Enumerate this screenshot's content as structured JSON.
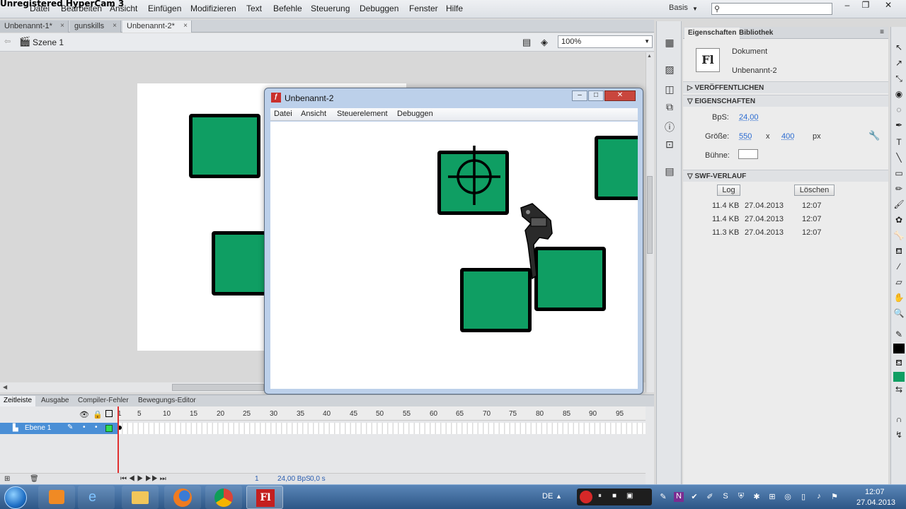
{
  "overlay": {
    "watermark": "Unregistered HyperCam 3"
  },
  "menubar": {
    "items": [
      "Datei",
      "Bearbeiten",
      "Ansicht",
      "Einfügen",
      "Modifizieren",
      "Text",
      "Befehle",
      "Steuerung",
      "Debuggen",
      "Fenster",
      "Hilfe"
    ],
    "workspace": "Basis",
    "search_placeholder": ""
  },
  "doc_tabs": [
    {
      "label": "Unbenannt-1*"
    },
    {
      "label": "gunskills"
    },
    {
      "label": "Unbenannt-2*"
    }
  ],
  "editbar": {
    "scene": "Szene 1",
    "zoom": "100%"
  },
  "swf_window": {
    "title": "Unbenannt-2",
    "menu": [
      "Datei",
      "Ansicht",
      "Steuerelement",
      "Debuggen"
    ]
  },
  "timeline": {
    "tabs": [
      "Zeitleiste",
      "Ausgabe",
      "Compiler-Fehler",
      "Bewegungs-Editor"
    ],
    "layer_name": "Ebene 1",
    "frame_ticks": [
      "1",
      "5",
      "10",
      "15",
      "20",
      "25",
      "30",
      "35",
      "40",
      "45",
      "50",
      "55",
      "60",
      "65",
      "70",
      "75",
      "80",
      "85",
      "90",
      "95"
    ],
    "current_frame": "1",
    "fps": "24,00 BpS",
    "time": "0,0 s"
  },
  "properties": {
    "tabs": [
      "Eigenschaften",
      "Bibliothek"
    ],
    "doc_type": "Dokument",
    "doc_name": "Unbenannt-2",
    "logo_text": "Fl",
    "sections": {
      "publish": "VERÖFFENTLICHEN",
      "properties": "EIGENSCHAFTEN",
      "swf_history": "SWF-VERLAUF"
    },
    "fps_label": "BpS:",
    "fps_value": "24,00",
    "size_label": "Größe:",
    "width": "550",
    "x_sep": "x",
    "height": "400",
    "unit": "px",
    "stage_label": "Bühne:",
    "log_button": "Log",
    "clear_button": "Löschen",
    "log": [
      {
        "size": "11.4 KB",
        "date": "27.04.2013",
        "time": "12:07"
      },
      {
        "size": "11.4 KB",
        "date": "27.04.2013",
        "time": "12:07"
      },
      {
        "size": "11.3 KB",
        "date": "27.04.2013",
        "time": "12:07"
      }
    ]
  },
  "taskbar": {
    "lang": "DE",
    "time": "12:07",
    "date": "27.04.2013"
  },
  "colors": {
    "shape_fill": "#0f9e63",
    "accent": "#2a6ad0"
  }
}
